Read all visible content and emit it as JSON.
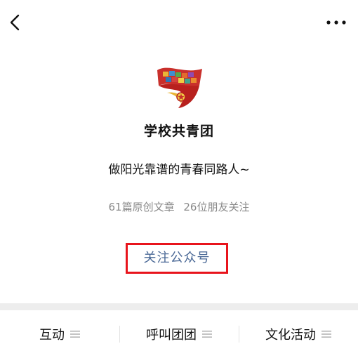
{
  "topbar": {
    "back_icon": "chevron-left-icon",
    "more_icon": "more-dots-icon"
  },
  "profile": {
    "logo_icon": "communist-youth-league-logo",
    "name": "学校共青团",
    "slogan": "做阳光靠谱的青春同路人~",
    "articles": "61篇原创文章",
    "followers": "26位朋友关注"
  },
  "follow_button": {
    "label": "关注公众号",
    "label_color": "#4a6896",
    "highlight_color": "#e8141c"
  },
  "bottom_menu": {
    "items": [
      {
        "label": "互动",
        "icon": "menu-lines-icon"
      },
      {
        "label": "呼叫团团",
        "icon": "menu-lines-icon"
      },
      {
        "label": "文化活动",
        "icon": "menu-lines-icon"
      }
    ]
  }
}
